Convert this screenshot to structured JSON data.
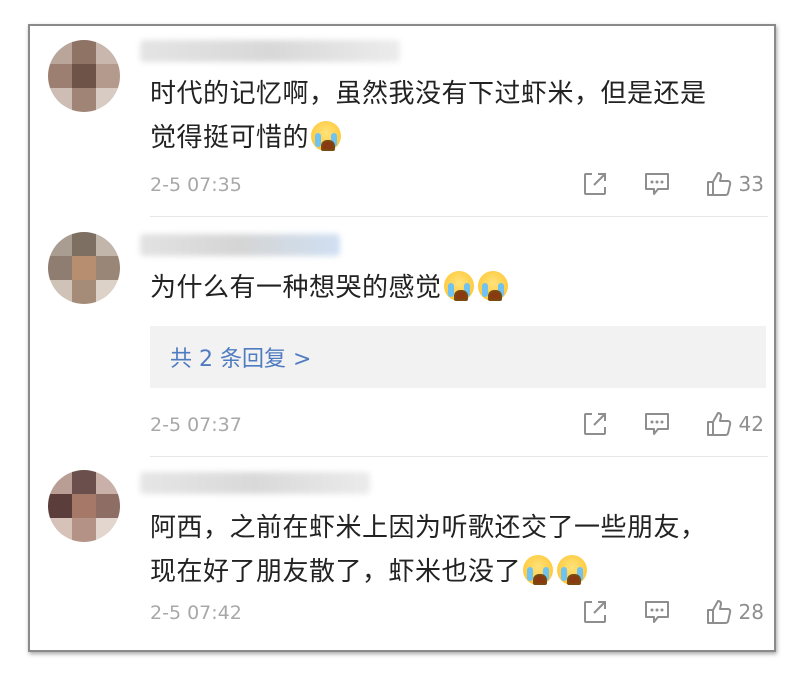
{
  "comments": [
    {
      "text_line1": "时代的记忆啊，虽然我没有下过虾米，但是还是",
      "text_line2": "觉得挺可惜的",
      "emoji": [
        "crying-face"
      ],
      "time": "2-5 07:35",
      "likes": "33"
    },
    {
      "text_line1": "为什么有一种想哭的感觉",
      "emoji": [
        "crying-face",
        "crying-face"
      ],
      "replies_label": "共 2 条回复 >",
      "time": "2-5 07:37",
      "likes": "42"
    },
    {
      "text_line1": "阿西，之前在虾米上因为听歌还交了一些朋友，",
      "text_line2": "现在好了朋友散了，虾米也没了",
      "emoji": [
        "crying-face",
        "crying-face"
      ],
      "time": "2-5 07:42",
      "likes": "28"
    }
  ],
  "icons": {
    "share": "share-icon",
    "comment": "comment-icon",
    "like": "thumbs-up-icon"
  },
  "colors": {
    "reply_link": "#4f7cc0",
    "meta_text": "#a8a8a8",
    "body_text": "#222222"
  }
}
